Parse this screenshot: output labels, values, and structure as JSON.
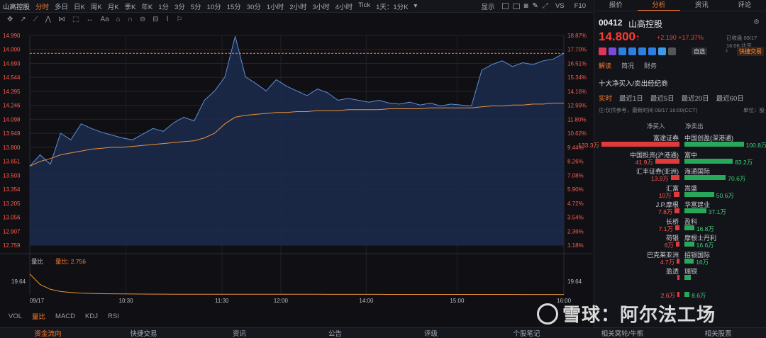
{
  "toolbar": {
    "stock_name": "山高控股",
    "periods": [
      "分时",
      "多日",
      "日K",
      "周K",
      "月K",
      "季K",
      "年K",
      "1分",
      "3分",
      "5分",
      "10分",
      "15分",
      "30分",
      "1小时",
      "2小时",
      "3小时",
      "4小时",
      "Tick"
    ],
    "active_period": "分时",
    "interval_select": "1天：1分K",
    "show_label": "显示",
    "vs_label": "VS",
    "fq_label": "F10"
  },
  "drawing_tools": [
    "✥",
    "↗",
    "⟋",
    "⋀",
    "⋈",
    "⬚",
    "↔",
    "Aa",
    "⌂",
    "∩",
    "⊖",
    "⊟",
    "⌇",
    "⚐"
  ],
  "chart": {
    "price_ticks": [
      "14.990",
      "14.000",
      "14.693",
      "14.544",
      "14.395",
      "14.246",
      "14.098",
      "13.949",
      "13.800",
      "13.651",
      "13.503",
      "13.354",
      "13.205",
      "13.056",
      "12.907",
      "12.759"
    ],
    "pct_ticks": [
      "18.87%",
      "17.70%",
      "16.51%",
      "15.34%",
      "14.16%",
      "12.99%",
      "11.80%",
      "10.62%",
      "9.44%",
      "8.26%",
      "7.08%",
      "5.90%",
      "4.72%",
      "3.54%",
      "2.36%",
      "1.18%"
    ],
    "time_labels": [
      "09/17",
      "10:30",
      "11:30",
      "12:00",
      "14:00",
      "15:00",
      "16:00"
    ],
    "volume_ratio_label": "量比",
    "volume_ratio_value": "量比: 2.756",
    "volume_axis_value": "19.64",
    "colors": {
      "price_line": "#5b8fd8",
      "avg_line": "#e8913a",
      "up": "#ff3b30",
      "down": "#27a85b",
      "accent": "#ff7a2a"
    }
  },
  "chart_data": {
    "type": "area",
    "title": "",
    "xlabel": "",
    "ylabel": "",
    "ylim": [
      12.759,
      14.99
    ],
    "x": [
      "09:30",
      "09:33",
      "09:36",
      "09:40",
      "09:45",
      "09:50",
      "09:55",
      "10:00",
      "10:05",
      "10:10",
      "10:15",
      "10:20",
      "10:25",
      "10:30",
      "10:35",
      "10:40",
      "10:45",
      "10:50",
      "10:55",
      "11:00",
      "11:05",
      "11:10",
      "11:15",
      "11:20",
      "11:25",
      "11:30",
      "11:35",
      "11:40",
      "11:45",
      "11:50",
      "11:55",
      "12:00",
      "13:00",
      "13:10",
      "13:20",
      "13:30",
      "13:40",
      "13:50",
      "14:00",
      "14:10",
      "14:20",
      "14:30",
      "14:40",
      "14:50",
      "15:00",
      "15:05",
      "15:10",
      "15:20",
      "15:30",
      "15:40",
      "15:50",
      "15:55",
      "16:00"
    ],
    "series": [
      {
        "name": "",
        "values": [
          13.6,
          13.72,
          13.62,
          13.95,
          13.88,
          14.05,
          14.0,
          13.96,
          13.93,
          13.9,
          13.88,
          13.94,
          14.0,
          13.97,
          14.06,
          14.12,
          14.08,
          14.3,
          14.4,
          14.55,
          14.98,
          14.55,
          14.48,
          14.4,
          14.52,
          14.45,
          14.4,
          14.35,
          14.42,
          14.38,
          14.3,
          14.32,
          14.3,
          14.28,
          14.3,
          14.27,
          14.26,
          14.28,
          14.25,
          14.27,
          14.24,
          14.26,
          14.25,
          14.24,
          14.62,
          14.68,
          14.72,
          14.66,
          14.7,
          14.68,
          14.72,
          14.74,
          14.8
        ]
      },
      {
        "name": "",
        "values": [
          13.6,
          13.65,
          13.68,
          13.72,
          13.74,
          13.76,
          13.78,
          13.79,
          13.8,
          13.8,
          13.81,
          13.82,
          13.83,
          13.84,
          13.85,
          13.86,
          13.87,
          13.9,
          13.95,
          14.05,
          14.12,
          14.14,
          14.15,
          14.16,
          14.17,
          14.17,
          14.18,
          14.18,
          14.19,
          14.19,
          14.19,
          14.2,
          14.2,
          14.2,
          14.2,
          14.21,
          14.21,
          14.21,
          14.21,
          14.22,
          14.22,
          14.22,
          14.22,
          14.22,
          14.23,
          14.24,
          14.24,
          14.25,
          14.25,
          14.26,
          14.26,
          14.27,
          14.27
        ]
      }
    ],
    "reference_line": 14.8,
    "volume_ratio": [
      19.64,
      11.0,
      7.0,
      5.2,
      4.4,
      3.9,
      3.6,
      3.4,
      3.3,
      3.2,
      3.15,
      3.1,
      3.05,
      3.0,
      2.98,
      2.96,
      2.94,
      2.92,
      2.92,
      2.95,
      2.98,
      2.97,
      2.95,
      2.93,
      2.92,
      2.9,
      2.89,
      2.88,
      2.88,
      2.87,
      2.86,
      2.86,
      2.85,
      2.84,
      2.83,
      2.82,
      2.81,
      2.81,
      2.8,
      2.8,
      2.79,
      2.79,
      2.78,
      2.78,
      2.78,
      2.77,
      2.77,
      2.77,
      2.76,
      2.76,
      2.76,
      2.76,
      2.756
    ]
  },
  "bottom_tabs": [
    "VOL",
    "量比",
    "MACD",
    "KDJ",
    "RSI"
  ],
  "active_bottom_tab": "量比",
  "footer_tabs": [
    "资金流向",
    "快捷交易",
    "资讯",
    "公告",
    "评级",
    "个股笔记",
    "相关窝轮/牛熊",
    "相关股票"
  ],
  "panel": {
    "tabs": [
      "报价",
      "分析",
      "资讯",
      "评论"
    ],
    "active_tab": "分析",
    "code": "00412",
    "name": "山高控股",
    "price": "14.800",
    "arrow": "↑",
    "change": "+2.190 +17.37%",
    "closed": "已收盘 09/17 16:08 北京",
    "watch_label": "自选",
    "trade_label": "快捷交易",
    "subtabs": [
      "解读",
      "简况",
      "财务"
    ],
    "section_title": "十大净买入/卖出经纪商",
    "periods": [
      "实时",
      "最近1日",
      "最近5日",
      "最近20日",
      "最近60日"
    ],
    "note": "注:仅供参考，最新时间 09/17 16:00(CCT)",
    "unit": "单位：股",
    "col_buy": "净买入",
    "col_sell": "净卖出",
    "brokers": [
      {
        "buy": "富途证券",
        "buy_val": "133.3万",
        "buy_w": 1.0,
        "sell": "中国创盈(深港通)",
        "sell_val": "100.8万",
        "sell_w": 0.76
      },
      {
        "buy": "中国投资(沪港通)",
        "buy_val": "41.9万",
        "buy_w": 0.31,
        "sell": "富中",
        "sell_val": "83.2万",
        "sell_w": 0.62
      },
      {
        "buy": "汇丰证券(亚洲)",
        "buy_val": "13.9万",
        "buy_w": 0.11,
        "sell": "海通国际",
        "sell_val": "70.6万",
        "sell_w": 0.53
      },
      {
        "buy": "汇富",
        "buy_val": "10万",
        "buy_w": 0.075,
        "sell": "嵩盛",
        "sell_val": "50.6万",
        "sell_w": 0.38
      },
      {
        "buy": "J.P.摩根",
        "buy_val": "7.8万",
        "buy_w": 0.06,
        "sell": "华富建业",
        "sell_val": "37.1万",
        "sell_w": 0.28
      },
      {
        "buy": "长桥",
        "buy_val": "7.1万",
        "buy_w": 0.055,
        "sell": "盈科",
        "sell_val": "16.8万",
        "sell_w": 0.126
      },
      {
        "buy": "荷银",
        "buy_val": "6万",
        "buy_w": 0.045,
        "sell": "摩根士丹利",
        "sell_val": "16.6万",
        "sell_w": 0.124
      },
      {
        "buy": "巴克莱亚洲",
        "buy_val": "4.7万",
        "buy_w": 0.035,
        "sell": "招银国际",
        "sell_val": "16万",
        "sell_w": 0.12
      },
      {
        "buy": "盈透",
        "buy_val": "",
        "buy_w": 0.03,
        "sell": "瑞银",
        "sell_val": "",
        "sell_w": 0.08
      },
      {
        "buy": "",
        "buy_val": "2.6万",
        "buy_w": 0.02,
        "sell": "",
        "sell_val": "8.6万",
        "sell_w": 0.065
      }
    ]
  },
  "watermark": "雪球：阿尔法工场"
}
